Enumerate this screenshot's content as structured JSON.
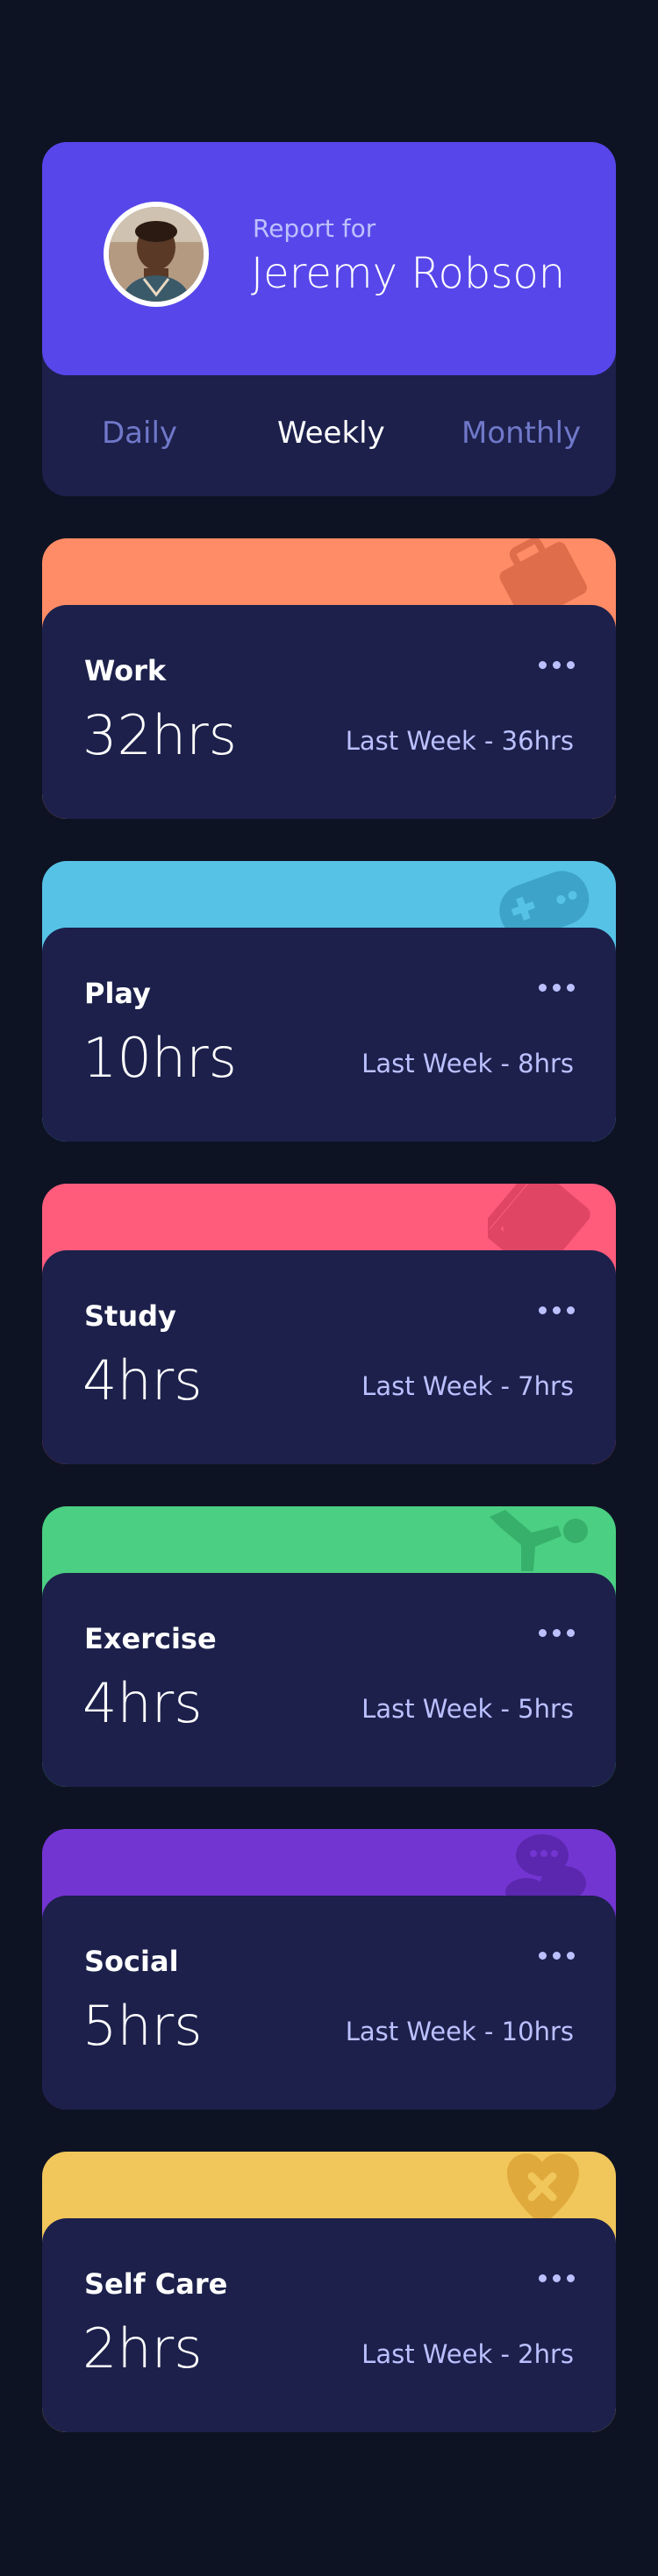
{
  "profile": {
    "report_for": "Report for",
    "name": "Jeremy Robson",
    "accent_color": "#5747ea"
  },
  "tabs": [
    {
      "label": "Daily",
      "active": false
    },
    {
      "label": "Weekly",
      "active": true
    },
    {
      "label": "Monthly",
      "active": false
    }
  ],
  "activities": [
    {
      "title": "Work",
      "hours": "32hrs",
      "previous": "Last Week - 36hrs",
      "color": "#ff8c66",
      "icon": "briefcase-icon"
    },
    {
      "title": "Play",
      "hours": "10hrs",
      "previous": "Last Week - 8hrs",
      "color": "#56c2e6",
      "icon": "gamepad-icon"
    },
    {
      "title": "Study",
      "hours": "4hrs",
      "previous": "Last Week - 7hrs",
      "color": "#ff5c7c",
      "icon": "book-icon"
    },
    {
      "title": "Exercise",
      "hours": "4hrs",
      "previous": "Last Week - 5hrs",
      "color": "#4bcf83",
      "icon": "running-icon"
    },
    {
      "title": "Social",
      "hours": "5hrs",
      "previous": "Last Week - 10hrs",
      "color": "#7335d2",
      "icon": "chat-icon"
    },
    {
      "title": "Self Care",
      "hours": "2hrs",
      "previous": "Last Week - 2hrs",
      "color": "#f1c65b",
      "icon": "heart-icon"
    }
  ],
  "colors": {
    "background": "#0e1323",
    "card": "#1c204b",
    "muted_text": "#bbc0ff",
    "tab_inactive": "#7078c9"
  }
}
